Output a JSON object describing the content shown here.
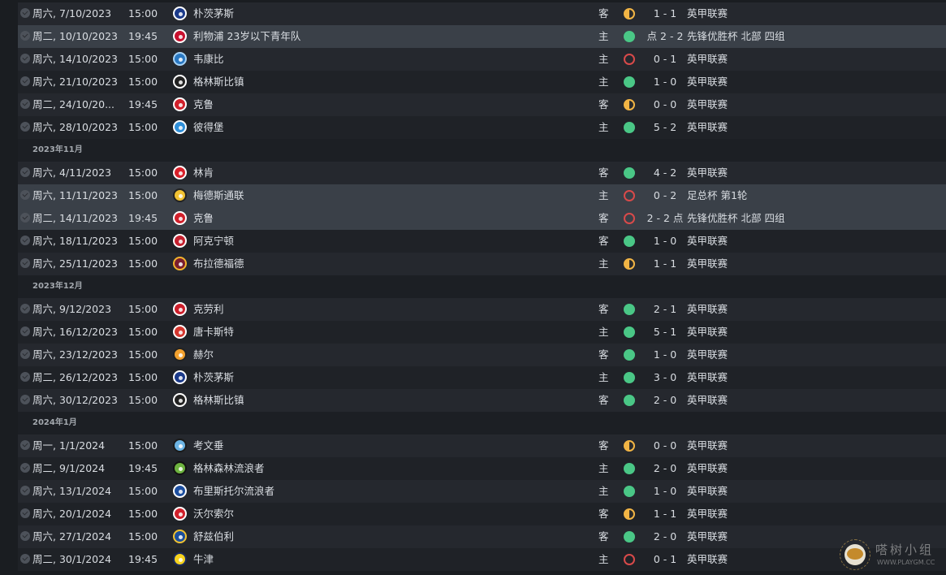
{
  "rows": [
    {
      "kind": "match",
      "date": "周六, 7/10/2023",
      "time": "15:00",
      "team": "朴茨茅斯",
      "crest": {
        "icon": "portsmouth-crest",
        "fill": "#1b3a8a",
        "ring": "#ffffff"
      },
      "venue": "客",
      "result": "D",
      "score": "1 - 1",
      "comp": "英甲联赛"
    },
    {
      "kind": "match",
      "date": "周二, 10/10/2023",
      "time": "19:45",
      "team": "利物浦 23岁以下青年队",
      "crest": {
        "icon": "liverpool-crest",
        "fill": "#c8102e",
        "ring": "#ffffff"
      },
      "venue": "主",
      "result": "W",
      "score": "点 2 - 2",
      "comp": "先锋优胜杯 北部 四组",
      "highlight": true
    },
    {
      "kind": "match",
      "date": "周六, 14/10/2023",
      "time": "15:00",
      "team": "韦康比",
      "crest": {
        "icon": "wycombe-crest",
        "fill": "#2a78c2",
        "ring": "#a7d2f5"
      },
      "venue": "主",
      "result": "L",
      "score": "0 - 1",
      "comp": "英甲联赛"
    },
    {
      "kind": "match",
      "date": "周六, 21/10/2023",
      "time": "15:00",
      "team": "格林斯比镇",
      "crest": {
        "icon": "grimsby-crest",
        "fill": "#222222",
        "ring": "#ffffff"
      },
      "venue": "主",
      "result": "W",
      "score": "1 - 0",
      "comp": "英甲联赛"
    },
    {
      "kind": "match",
      "date": "周二, 24/10/20...",
      "time": "19:45",
      "team": "克鲁",
      "crest": {
        "icon": "crewe-crest",
        "fill": "#d0202b",
        "ring": "#ffffff"
      },
      "venue": "客",
      "result": "D",
      "score": "0 - 0",
      "comp": "英甲联赛"
    },
    {
      "kind": "match",
      "date": "周六, 28/10/2023",
      "time": "15:00",
      "team": "彼得堡",
      "crest": {
        "icon": "peterborough-crest",
        "fill": "#2f8fd8",
        "ring": "#ffffff"
      },
      "venue": "主",
      "result": "W",
      "score": "5 - 2",
      "comp": "英甲联赛"
    },
    {
      "kind": "month",
      "label": "2023年11月"
    },
    {
      "kind": "match",
      "date": "周六, 4/11/2023",
      "time": "15:00",
      "team": "林肯",
      "crest": {
        "icon": "lincoln-crest",
        "fill": "#d8202a",
        "ring": "#ffffff"
      },
      "venue": "客",
      "result": "W",
      "score": "4 - 2",
      "comp": "英甲联赛"
    },
    {
      "kind": "match",
      "date": "周六, 11/11/2023",
      "time": "15:00",
      "team": "梅德斯通联",
      "crest": {
        "icon": "maidstone-crest",
        "fill": "#f1c232",
        "ring": "#222222"
      },
      "venue": "主",
      "result": "L",
      "score": "0 - 2",
      "comp": "足总杯 第1轮",
      "highlight": true
    },
    {
      "kind": "match",
      "date": "周二, 14/11/2023",
      "time": "19:45",
      "team": "克鲁",
      "crest": {
        "icon": "crewe-crest",
        "fill": "#d0202b",
        "ring": "#ffffff"
      },
      "venue": "客",
      "result": "L",
      "score": "2 - 2 点",
      "comp": "先锋优胜杯 北部 四组",
      "highlight": true
    },
    {
      "kind": "match",
      "date": "周六, 18/11/2023",
      "time": "15:00",
      "team": "阿克宁顿",
      "crest": {
        "icon": "accrington-crest",
        "fill": "#c4212f",
        "ring": "#ffffff"
      },
      "venue": "客",
      "result": "W",
      "score": "1 - 0",
      "comp": "英甲联赛"
    },
    {
      "kind": "match",
      "date": "周六, 25/11/2023",
      "time": "15:00",
      "team": "布拉德福德",
      "crest": {
        "icon": "bradford-crest",
        "fill": "#7a1e2e",
        "ring": "#f2b32c"
      },
      "venue": "主",
      "result": "D",
      "score": "1 - 1",
      "comp": "英甲联赛"
    },
    {
      "kind": "month",
      "label": "2023年12月"
    },
    {
      "kind": "match",
      "date": "周六, 9/12/2023",
      "time": "15:00",
      "team": "克劳利",
      "crest": {
        "icon": "crawley-crest",
        "fill": "#cc1f2b",
        "ring": "#ffffff"
      },
      "venue": "客",
      "result": "W",
      "score": "2 - 1",
      "comp": "英甲联赛"
    },
    {
      "kind": "match",
      "date": "周六, 16/12/2023",
      "time": "15:00",
      "team": "唐卡斯特",
      "crest": {
        "icon": "doncaster-crest",
        "fill": "#d4362e",
        "ring": "#ffffff"
      },
      "venue": "主",
      "result": "W",
      "score": "5 - 1",
      "comp": "英甲联赛"
    },
    {
      "kind": "match",
      "date": "周六, 23/12/2023",
      "time": "15:00",
      "team": "赫尔",
      "crest": {
        "icon": "hull-crest",
        "fill": "#f3a12e",
        "ring": "#222222"
      },
      "venue": "客",
      "result": "W",
      "score": "1 - 0",
      "comp": "英甲联赛"
    },
    {
      "kind": "match",
      "date": "周二, 26/12/2023",
      "time": "15:00",
      "team": "朴茨茅斯",
      "crest": {
        "icon": "portsmouth-crest",
        "fill": "#1b3a8a",
        "ring": "#ffffff"
      },
      "venue": "主",
      "result": "W",
      "score": "3 - 0",
      "comp": "英甲联赛"
    },
    {
      "kind": "match",
      "date": "周六, 30/12/2023",
      "time": "15:00",
      "team": "格林斯比镇",
      "crest": {
        "icon": "grimsby-crest",
        "fill": "#222222",
        "ring": "#ffffff"
      },
      "venue": "客",
      "result": "W",
      "score": "2 - 0",
      "comp": "英甲联赛"
    },
    {
      "kind": "month",
      "label": "2024年1月"
    },
    {
      "kind": "match",
      "date": "周一, 1/1/2024",
      "time": "15:00",
      "team": "考文垂",
      "crest": {
        "icon": "coventry-crest",
        "fill": "#6cb4e4",
        "ring": "#1a1a1a"
      },
      "venue": "客",
      "result": "D",
      "score": "0 - 0",
      "comp": "英甲联赛"
    },
    {
      "kind": "match",
      "date": "周二, 9/1/2024",
      "time": "19:45",
      "team": "格林森林流浪者",
      "crest": {
        "icon": "forest-green-crest",
        "fill": "#6db33f",
        "ring": "#111111"
      },
      "venue": "主",
      "result": "W",
      "score": "2 - 0",
      "comp": "英甲联赛"
    },
    {
      "kind": "match",
      "date": "周六, 13/1/2024",
      "time": "15:00",
      "team": "布里斯托尔流浪者",
      "crest": {
        "icon": "bristol-rovers-crest",
        "fill": "#1d4fa0",
        "ring": "#ffffff"
      },
      "venue": "主",
      "result": "W",
      "score": "1 - 0",
      "comp": "英甲联赛"
    },
    {
      "kind": "match",
      "date": "周六, 20/1/2024",
      "time": "15:00",
      "team": "沃尔索尔",
      "crest": {
        "icon": "walsall-crest",
        "fill": "#d0202b",
        "ring": "#ffffff"
      },
      "venue": "客",
      "result": "D",
      "score": "1 - 1",
      "comp": "英甲联赛"
    },
    {
      "kind": "match",
      "date": "周六, 27/1/2024",
      "time": "15:00",
      "team": "舒兹伯利",
      "crest": {
        "icon": "shrewsbury-crest",
        "fill": "#1b4f9c",
        "ring": "#f1c232"
      },
      "venue": "客",
      "result": "W",
      "score": "2 - 0",
      "comp": "英甲联赛"
    },
    {
      "kind": "match",
      "date": "周二, 30/1/2024",
      "time": "19:45",
      "team": "牛津",
      "crest": {
        "icon": "oxford-crest",
        "fill": "#f5d21e",
        "ring": "#1b2a5a"
      },
      "venue": "主",
      "result": "L",
      "score": "0 - 1",
      "comp": "英甲联赛"
    }
  ],
  "watermark": {
    "text": "嗒树小组",
    "site": "WWW.PLAYGM.CC",
    "icon": "playgm-logo"
  }
}
